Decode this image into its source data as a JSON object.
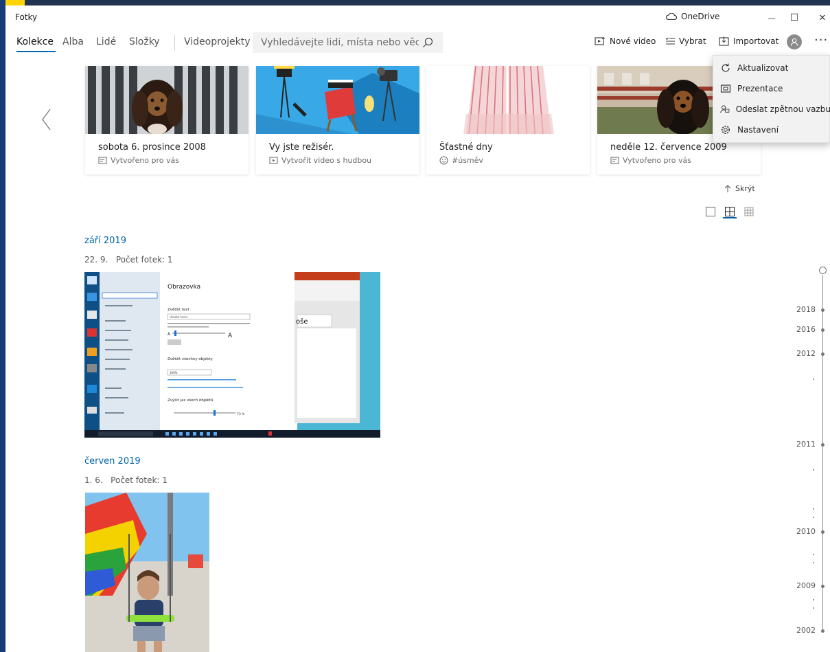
{
  "window": {
    "title": "Fotky",
    "onedrive_label": "OneDrive",
    "minimize_glyph": "—",
    "maximize_glyph": "☐",
    "close_glyph": "✕"
  },
  "nav": {
    "tabs": [
      {
        "label": "Kolekce",
        "active": true
      },
      {
        "label": "Alba"
      },
      {
        "label": "Lidé"
      },
      {
        "label": "Složky"
      },
      {
        "label": "Videoprojekty"
      }
    ],
    "search_placeholder": "Vyhledávejte lidi, místa nebo věci...",
    "commands": {
      "new_video": "Nové video",
      "select": "Vybrat",
      "import": "Importovat"
    },
    "more_glyph": "···"
  },
  "menu": {
    "items": [
      {
        "label": "Aktualizovat",
        "icon": "refresh-icon"
      },
      {
        "label": "Prezentace",
        "icon": "slideshow-icon"
      },
      {
        "label": "Odeslat zpětnou vazbu",
        "icon": "feedback-icon"
      },
      {
        "label": "Nastavení",
        "icon": "settings-icon"
      }
    ]
  },
  "carousel": {
    "cards": [
      {
        "title": "sobota 6. prosince 2008",
        "subtitle": "Vytvořeno pro vás",
        "icon": "album-icon"
      },
      {
        "title": "Vy jste režisér.",
        "subtitle": "Vytvořit video s hudbou",
        "icon": "video-icon"
      },
      {
        "title": "Šťastné dny",
        "subtitle": "#úsměv",
        "icon": "smile-icon"
      },
      {
        "title": "neděle 12. července 2009",
        "subtitle": "Vytvořeno pro vás",
        "icon": "album-icon"
      }
    ],
    "hide_label": "Skrýt"
  },
  "groups": [
    {
      "month": "září 2019",
      "date": "22. 9.",
      "count_label": "Počet fotek: 1"
    },
    {
      "month": "červen 2019",
      "date": "1. 6.",
      "count_label": "Počet fotek: 1"
    }
  ],
  "screenshot_text": {
    "panel_title": "Obrazovka",
    "section1": "Zvětšit text",
    "sample": "Ukázka textu",
    "slider_letter": "A",
    "section2": "Zvětšit všechny objekty",
    "scale_value": "100%",
    "section3": "Zvýšit jas všech objektů",
    "bright_value": "73 %",
    "word": "oše"
  },
  "timeline": {
    "years": [
      "2018",
      "2016",
      "2012",
      "2011",
      "2010",
      "2009",
      "2002"
    ]
  },
  "colors": {
    "accent": "#0063b1",
    "menu_bg": "#f2f2f2",
    "frame": "#1a3b7a"
  }
}
